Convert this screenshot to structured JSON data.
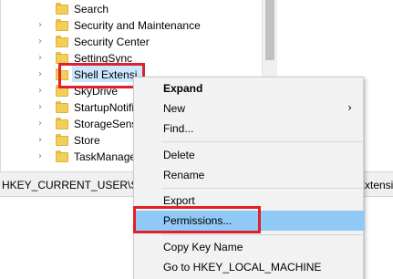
{
  "tree": {
    "items": [
      {
        "label": "Search",
        "has_arrow": false
      },
      {
        "label": "Security and Maintenance",
        "has_arrow": true
      },
      {
        "label": "Security Center",
        "has_arrow": true
      },
      {
        "label": "SettingSync",
        "has_arrow": true
      },
      {
        "label": "Shell Extensi",
        "has_arrow": true,
        "selected": true
      },
      {
        "label": "SkyDrive",
        "has_arrow": true
      },
      {
        "label": "StartupNotifi",
        "has_arrow": true
      },
      {
        "label": "StorageSense",
        "has_arrow": true
      },
      {
        "label": "Store",
        "has_arrow": true
      },
      {
        "label": "TaskManager",
        "has_arrow": true
      }
    ]
  },
  "address_bar": {
    "path_left": "HKEY_CURRENT_USER\\Soft",
    "path_right": "Extensi"
  },
  "context_menu": {
    "items": [
      {
        "label": "Expand",
        "bold": true
      },
      {
        "label": "New",
        "submenu_icon": "chevron-right-icon"
      },
      {
        "label": "Find..."
      },
      {
        "label": "Delete"
      },
      {
        "label": "Rename"
      },
      {
        "label": "Export"
      },
      {
        "label": "Permissions...",
        "highlighted": true
      },
      {
        "label": "Copy Key Name"
      },
      {
        "label": "Go to HKEY_LOCAL_MACHINE"
      }
    ]
  },
  "colors": {
    "highlight_box": "#e0202a",
    "menu_hover": "#91c9f7",
    "selected_item": "#cce8ff",
    "folder": "#f3cf5a"
  }
}
